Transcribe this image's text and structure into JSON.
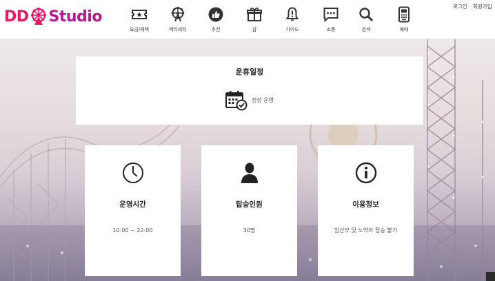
{
  "header": {
    "logo": {
      "left": "DD",
      "right": "Studio"
    },
    "nav": [
      {
        "label": "요금/혜택",
        "icon": "ticket-icon"
      },
      {
        "label": "액티비티",
        "icon": "ferris-wheel-icon"
      },
      {
        "label": "추천",
        "icon": "thumbs-up-icon"
      },
      {
        "label": "샵",
        "icon": "gift-box-icon"
      },
      {
        "label": "가이드",
        "icon": "bell-icon"
      },
      {
        "label": "소통",
        "icon": "chat-bubble-icon"
      },
      {
        "label": "검색",
        "icon": "search-icon"
      },
      {
        "label": "예매",
        "icon": "kiosk-icon"
      }
    ],
    "links": {
      "login": "로그인",
      "signup": "회원가입"
    }
  },
  "schedule": {
    "title": "운휴일정",
    "status": "정상 운영",
    "icon": "calendar-check-icon"
  },
  "cards": [
    {
      "title": "운영시간",
      "value": "10:00 ~ 22:00",
      "icon": "clock-icon"
    },
    {
      "title": "탑승인원",
      "value": "30명",
      "icon": "person-icon"
    },
    {
      "title": "이용정보",
      "value": "임산부 및 노약자 탑승 불가",
      "icon": "info-icon"
    }
  ],
  "colors": {
    "brand_pink": "#e8176a",
    "brand_purple": "#b8188f"
  }
}
